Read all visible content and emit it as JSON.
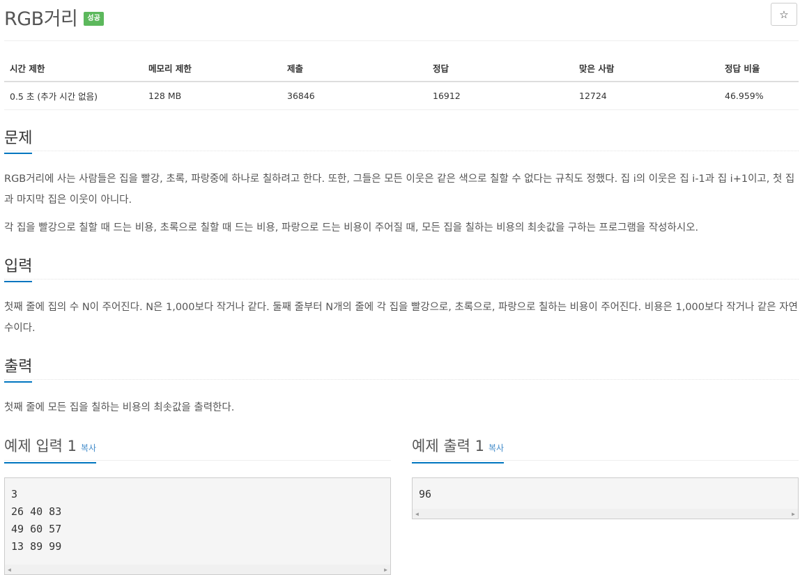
{
  "problem": {
    "title": "RGB거리",
    "badge": "성공",
    "star": "☆"
  },
  "info_table": {
    "headers": [
      "시간 제한",
      "메모리 제한",
      "제출",
      "정답",
      "맞은 사람",
      "정답 비율"
    ],
    "values": [
      "0.5 초 (추가 시간 없음)",
      "128 MB",
      "36846",
      "16912",
      "12724",
      "46.959%"
    ]
  },
  "sections": {
    "description": {
      "heading": "문제",
      "paragraphs": [
        "RGB거리에 사는 사람들은 집을 빨강, 초록, 파랑중에 하나로 칠하려고 한다. 또한, 그들은 모든 이웃은 같은 색으로 칠할 수 없다는 규칙도 정했다. 집 i의 이웃은 집 i-1과 집 i+1이고, 첫 집과 마지막 집은 이웃이 아니다.",
        "각 집을 빨강으로 칠할 때 드는 비용, 초록으로 칠할 때 드는 비용, 파랑으로 드는 비용이 주어질 때, 모든 집을 칠하는 비용의 최솟값을 구하는 프로그램을 작성하시오."
      ]
    },
    "input": {
      "heading": "입력",
      "text": "첫째 줄에 집의 수 N이 주어진다. N은 1,000보다 작거나 같다. 둘째 줄부터 N개의 줄에 각 집을 빨강으로, 초록으로, 파랑으로 칠하는 비용이 주어진다. 비용은 1,000보다 작거나 같은 자연수이다."
    },
    "output": {
      "heading": "출력",
      "text": "첫째 줄에 모든 집을 칠하는 비용의 최솟값을 출력한다."
    }
  },
  "samples": {
    "input": {
      "heading": "예제 입력 1",
      "copy": "복사",
      "content": "3\n26 40 83\n49 60 57\n13 89 99"
    },
    "output": {
      "heading": "예제 출력 1",
      "copy": "복사",
      "content": "96"
    }
  }
}
